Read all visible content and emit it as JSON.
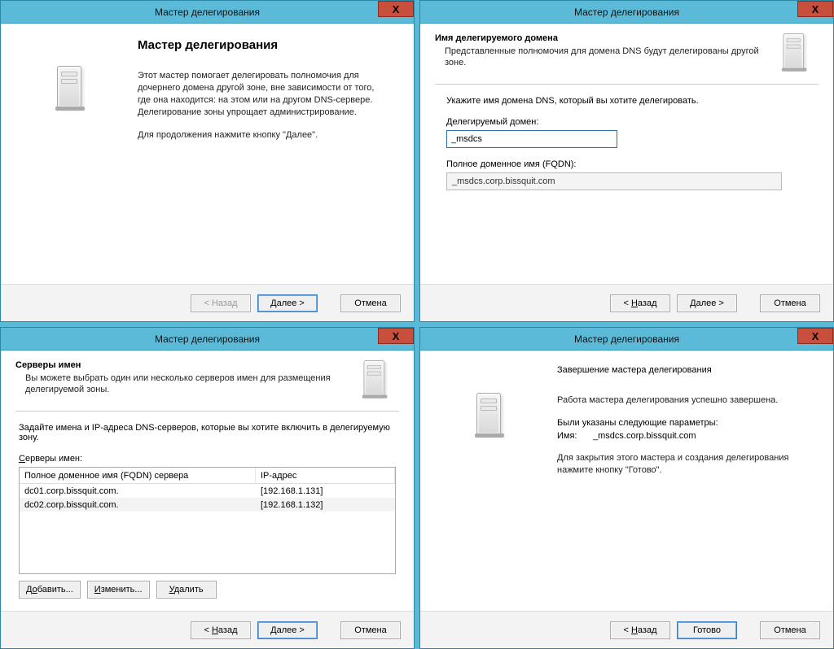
{
  "common": {
    "title": "Мастер делегирования",
    "close_x": "X",
    "back": "< Назад",
    "next": "Далее >",
    "cancel": "Отмена",
    "finish": "Готово"
  },
  "w1": {
    "heading": "Мастер делегирования",
    "p1": "Этот мастер помогает делегировать полномочия для дочернего домена другой зоне, вне зависимости от того, где она находится: на этом или на другом DNS-сервере. Делегирование зоны упрощает администрирование.",
    "p2": "Для продолжения нажмите кнопку \"Далее\"."
  },
  "w2": {
    "header_title": "Имя делегируемого домена",
    "header_desc": "Представленные полномочия для домена DNS будут делегированы другой зоне.",
    "instr": "Укажите имя домена DNS, который вы хотите делегировать.",
    "field_label": "Делегируемый домен:",
    "field_value": "_msdcs",
    "fqdn_label": "Полное доменное имя (FQDN):",
    "fqdn_value": "_msdcs.corp.bissquit.com"
  },
  "w3": {
    "header_title": "Серверы имен",
    "header_desc": "Вы можете выбрать один или несколько серверов имен для размещения делегируемой зоны.",
    "instr": "Задайте имена и IP-адреса DNS-серверов, которые вы хотите включить в делегируемую зону.",
    "list_label": "Серверы имен:",
    "col_fqdn": "Полное доменное имя (FQDN) сервера",
    "col_ip": "IP-адрес",
    "rows": [
      {
        "fqdn": "dc01.corp.bissquit.com.",
        "ip": "[192.168.1.131]"
      },
      {
        "fqdn": "dc02.corp.bissquit.com.",
        "ip": "[192.168.1.132]"
      }
    ],
    "add": "Добавить...",
    "edit": "Изменить...",
    "del": "Удалить"
  },
  "w4": {
    "heading": "Завершение мастера делегирования",
    "p1": "Работа мастера делегирования успешно завершена.",
    "p2": "Были указаны следующие параметры:",
    "name_k": "Имя:",
    "name_v": "_msdcs.corp.bissquit.com",
    "p3": "Для закрытия этого мастера и создания делегирования нажмите кнопку \"Готово\"."
  }
}
